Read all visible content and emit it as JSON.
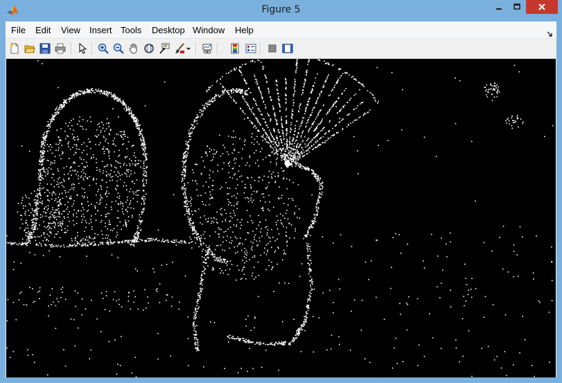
{
  "window": {
    "title": "Figure 5",
    "icon": "matlab-logo-icon"
  },
  "menubar": {
    "items": [
      "File",
      "Edit",
      "View",
      "Insert",
      "Tools",
      "Desktop",
      "Window",
      "Help"
    ]
  },
  "toolbar": {
    "buttons": [
      {
        "icon": "new-figure-icon"
      },
      {
        "icon": "open-file-icon"
      },
      {
        "icon": "save-icon"
      },
      {
        "icon": "print-icon"
      },
      {
        "icon": "edit-plot-arrow-icon"
      },
      {
        "icon": "zoom-in-icon"
      },
      {
        "icon": "zoom-out-icon"
      },
      {
        "icon": "pan-hand-icon"
      },
      {
        "icon": "rotate-3d-icon"
      },
      {
        "icon": "data-cursor-icon"
      },
      {
        "icon": "brush-icon"
      },
      {
        "icon": "brush-dropdown-icon"
      },
      {
        "icon": "link-plot-icon"
      },
      {
        "icon": "colorbar-icon"
      },
      {
        "icon": "legend-icon"
      },
      {
        "icon": "hide-plot-tools-icon"
      },
      {
        "icon": "show-plot-tools-icon"
      }
    ]
  },
  "figure": {
    "background": "#000000",
    "foreground": "#ffffff",
    "description_kind": "binary edge map image"
  },
  "colors": {
    "titlebar": "#7ab0de",
    "close_button": "#c7372e",
    "menubar": "#f5f6f7",
    "toolbar": "#f0f0f0"
  }
}
